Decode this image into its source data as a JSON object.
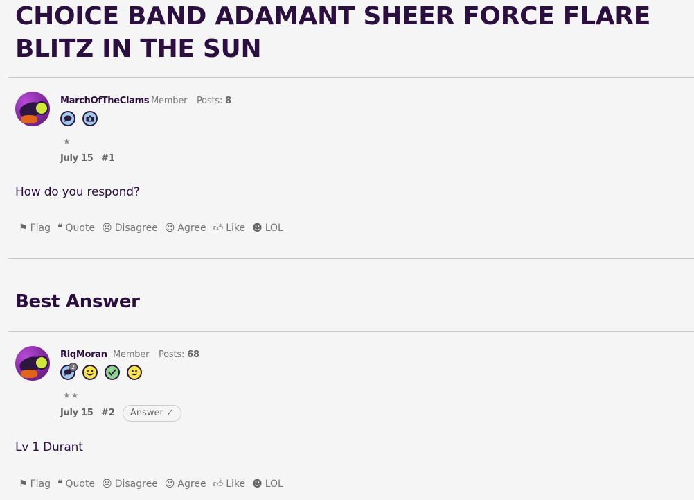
{
  "discussion": {
    "title": "CHOICE BAND ADAMANT SHEER FORCE FLARE BLITZ IN THE SUN"
  },
  "posts": [
    {
      "username": "MarchOfTheClams",
      "role": "Member",
      "posts_label": "Posts:",
      "posts_count": "8",
      "badges": [
        {
          "icon": "speech-bubble-badge-icon",
          "color": "#9ec8ec"
        },
        {
          "icon": "camera-badge-icon",
          "color": "#9ec8ec"
        }
      ],
      "stars": "★",
      "date": "July 15",
      "number": "#1",
      "body": "How do you respond?"
    },
    {
      "username": "RiqMoran",
      "role": "Member",
      "posts_label": "Posts:",
      "posts_count": "68",
      "badges": [
        {
          "icon": "speech-bubble-badge-icon",
          "color": "#9ec8ec",
          "count": "2"
        },
        {
          "icon": "wink-face-badge-icon",
          "color": "#f7e44a"
        },
        {
          "icon": "checkmark-badge-icon",
          "color": "#8fd48f"
        },
        {
          "icon": "smile-face-badge-icon",
          "color": "#f7e44a"
        }
      ],
      "stars": "★★",
      "date": "July 15",
      "number": "#2",
      "answer_tag": "Answer ✓",
      "body": "Lv 1 Durant"
    }
  ],
  "best_answer_heading": "Best Answer",
  "actions": {
    "flag": "Flag",
    "quote": "Quote",
    "disagree": "Disagree",
    "agree": "Agree",
    "like": "Like",
    "lol": "LOL"
  }
}
